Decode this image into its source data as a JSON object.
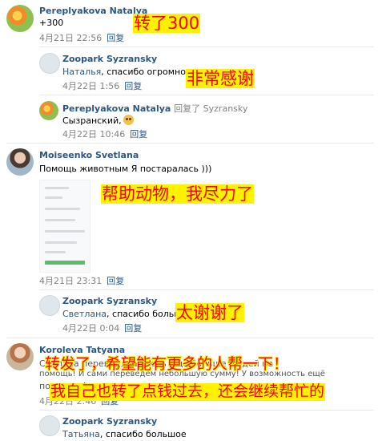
{
  "colors": {
    "link": "#2a5885",
    "meta": "#828282",
    "overlay_text": "#ff0000",
    "overlay_bg": "#fff200"
  },
  "comments": [
    {
      "author": "Pereplyakova Natalya",
      "text": "+300",
      "date": "4月21日 22:56",
      "reply_label": "回复",
      "overlay": "转了300"
    },
    {
      "author": "Zoopark Syzransky",
      "name_ref": "Наталья",
      "text": ", спасибо огромное",
      "date": "4月22日 1:56",
      "reply_label": "回复",
      "overlay": "非常感谢"
    },
    {
      "author": "Pereplyakova Natalya",
      "reply_to": "回复了 Syzransky",
      "text": "Сызранский,",
      "emoji": "smiling-face-icon",
      "date": "4月22日 10:46",
      "reply_label": "回复"
    },
    {
      "author": "Moiseenko Svetlana",
      "text": "Помощь животным Я постаралась )))",
      "date": "4月21日 23:31",
      "reply_label": "回复",
      "overlay": "帮助动物，我尽力了"
    },
    {
      "author": "Zoopark Syzransky",
      "name_ref": "Светлана",
      "text": ", спасибо большое",
      "date": "4月22日 0:04",
      "reply_label": "回复",
      "overlay": "太谢谢了"
    },
    {
      "author": "Koroleva Tatyana",
      "text_line1": "Сделала перевод, надеюсь ещё больше людей на",
      "text_line2": "помощь! И сами переведем небольшую сумму! У возможность ещё",
      "text_line3": "помогать!",
      "date": "4月22日 2:46",
      "reply_label": "回复",
      "overlay_line1": "转发了，希望能有更多的人帮一下！",
      "overlay_line2": "我自己也转了点钱过去，还会继续帮忙的"
    },
    {
      "author": "Zoopark Syzransky",
      "name_ref": "Татьяна",
      "text": ", спасибо большое",
      "reply_label": "回复"
    }
  ]
}
